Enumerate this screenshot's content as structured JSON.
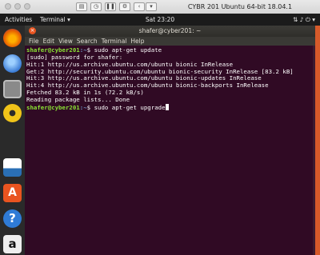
{
  "vm_window": {
    "title": "CYBR 201 Ubuntu 64-bit 18.04.1"
  },
  "top_bar": {
    "activities": "Activities",
    "app_menu": "Terminal ▾",
    "clock": "Sat 23:20"
  },
  "dock": {
    "items": [
      {
        "name": "firefox",
        "color": "#e66000"
      },
      {
        "name": "thunderbird",
        "color": "#3a7bd5"
      },
      {
        "name": "files",
        "color": "#8a8a8a"
      },
      {
        "name": "rhythmbox",
        "color": "#f0c419"
      },
      {
        "name": "libreoffice-writer",
        "color": "#2a6fb5"
      },
      {
        "name": "ubuntu-software",
        "color": "#e95420"
      },
      {
        "name": "help",
        "color": "#2f7bd6"
      },
      {
        "name": "amazon",
        "color": "#eeeeee"
      }
    ]
  },
  "terminal_window": {
    "title": "shafer@cyber201: ~",
    "menu": [
      "File",
      "Edit",
      "View",
      "Search",
      "Terminal",
      "Help"
    ]
  },
  "terminal": {
    "prompt_user": "shafer@cyber201",
    "prompt_path": ":~",
    "prompt_symbol": "$ ",
    "command1": "sudo apt-get update",
    "output": [
      "[sudo] password for shafer:",
      "Hit:1 http://us.archive.ubuntu.com/ubuntu bionic InRelease",
      "Get:2 http://security.ubuntu.com/ubuntu bionic-security InRelease [83.2 kB]",
      "Hit:3 http://us.archive.ubuntu.com/ubuntu bionic-updates InRelease",
      "Hit:4 http://us.archive.ubuntu.com/ubuntu bionic-backports InRelease",
      "Fetched 83.2 kB in 1s (72.2 kB/s)",
      "Reading package lists... Done"
    ],
    "command2": "sudo apt-get upgrade"
  },
  "colors": {
    "terminal_bg": "#300a24",
    "prompt_user": "#8ae234",
    "prompt_path": "#729fcf",
    "accent": "#e95420"
  }
}
